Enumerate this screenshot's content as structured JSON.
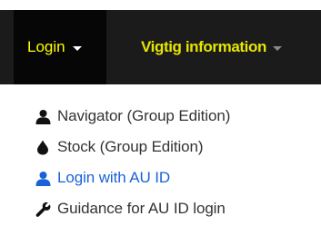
{
  "navbar": {
    "login": {
      "label": "Login"
    },
    "info": {
      "label": "Vigtig information"
    }
  },
  "dropdown": {
    "items": [
      {
        "label": "Navigator (Group Edition)",
        "icon": "user-icon",
        "active": false
      },
      {
        "label": "Stock (Group Edition)",
        "icon": "tint-icon",
        "active": false
      },
      {
        "label": "Login with AU ID",
        "icon": "user-icon",
        "active": true
      },
      {
        "label": "Guidance for AU ID login",
        "icon": "wrench-icon",
        "active": false
      }
    ]
  },
  "colors": {
    "navbar_bg": "#1b1b1b",
    "active_nav_bg": "#060606",
    "nav_text": "#ffff00",
    "menu_text": "#333333",
    "menu_active": "#1a62d6"
  }
}
